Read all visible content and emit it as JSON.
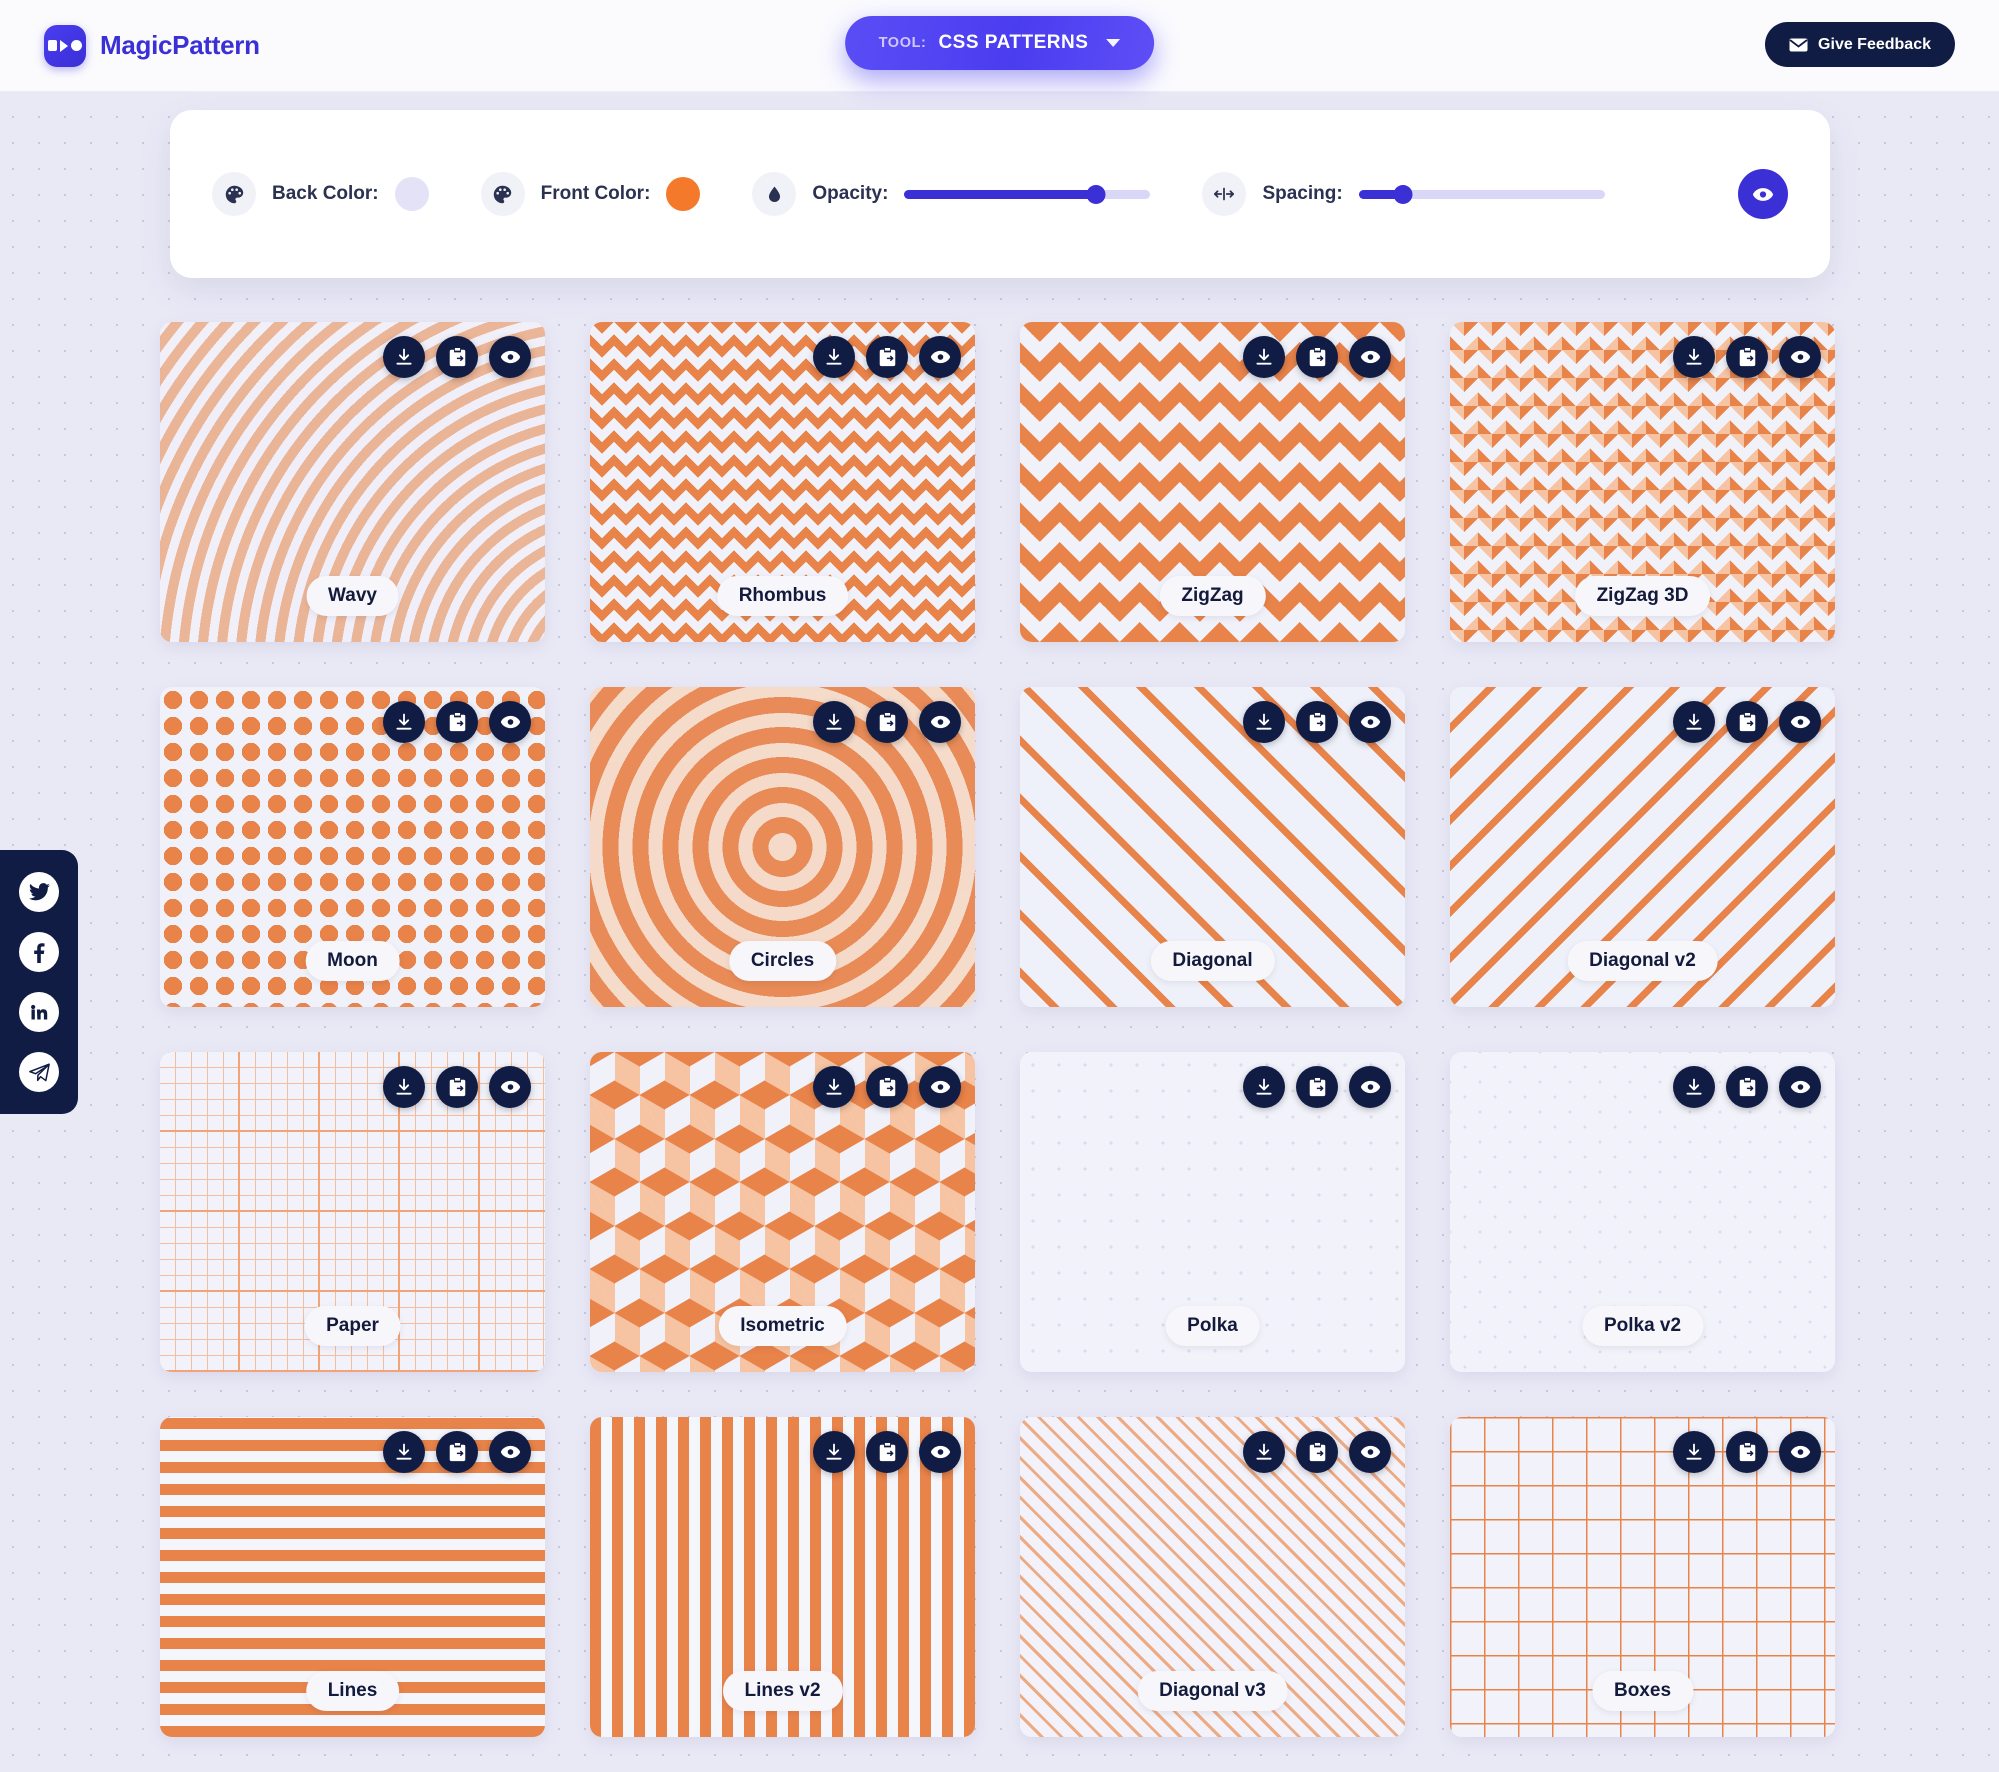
{
  "header": {
    "brand_name": "MagicPattern",
    "logo_icon": "magicpattern-logo-icon",
    "tool_kicker": "TOOL:",
    "tool_value": "CSS PATTERNS",
    "chevron_icon": "chevron-down-icon",
    "feedback_label": "Give Feedback",
    "feedback_icon": "envelope-icon"
  },
  "controls": {
    "back_color": {
      "label": "Back Color:",
      "icon": "palette-icon",
      "value": "#e4e2f6"
    },
    "front_color": {
      "label": "Front Color:",
      "icon": "palette-icon",
      "value": "#f4792b"
    },
    "opacity": {
      "label": "Opacity:",
      "icon": "droplet-icon",
      "percent": 78
    },
    "spacing": {
      "label": "Spacing:",
      "icon": "arrows-horizontal-icon",
      "percent": 18
    },
    "preview_button_icon": "eye-icon"
  },
  "social": {
    "items": [
      {
        "name": "twitter",
        "icon": "twitter-icon"
      },
      {
        "name": "facebook",
        "icon": "facebook-icon"
      },
      {
        "name": "linkedin",
        "icon": "linkedin-icon"
      },
      {
        "name": "telegram",
        "icon": "telegram-icon"
      }
    ]
  },
  "card_actions": {
    "download": {
      "label": "Download",
      "icon": "download-icon"
    },
    "copy": {
      "label": "Copy CSS",
      "icon": "clipboard-copy-icon"
    },
    "preview": {
      "label": "Preview",
      "icon": "eye-icon"
    }
  },
  "patterns": [
    {
      "name": "Wavy",
      "css": "p-wavy"
    },
    {
      "name": "Rhombus",
      "css": "p-rhombus"
    },
    {
      "name": "ZigZag",
      "css": "p-zigzag"
    },
    {
      "name": "ZigZag 3D",
      "css": "p-zigzag3d"
    },
    {
      "name": "Moon",
      "css": "p-moon"
    },
    {
      "name": "Circles",
      "css": "p-circles"
    },
    {
      "name": "Diagonal",
      "css": "p-diagonal"
    },
    {
      "name": "Diagonal v2",
      "css": "p-diagonal2"
    },
    {
      "name": "Paper",
      "css": "p-paper"
    },
    {
      "name": "Isometric",
      "css": "p-isometric"
    },
    {
      "name": "Polka",
      "css": "p-polka"
    },
    {
      "name": "Polka v2",
      "css": "p-polka2"
    },
    {
      "name": "Lines",
      "css": "p-lines"
    },
    {
      "name": "Lines v2",
      "css": "p-lines2"
    },
    {
      "name": "Diagonal v3",
      "css": "p-diagonal3"
    },
    {
      "name": "Boxes",
      "css": "p-boxes"
    }
  ],
  "colors": {
    "brand": "#3b2fd6",
    "dark": "#111c44",
    "accent_orange": "#f4792b",
    "page_bg": "#e9e9f6"
  }
}
